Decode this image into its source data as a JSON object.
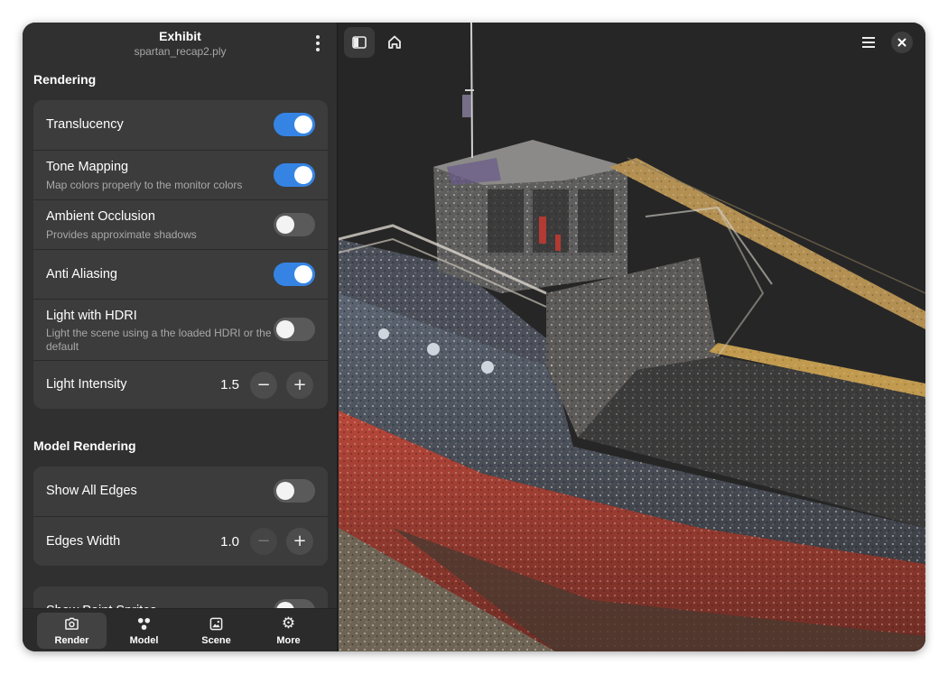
{
  "header": {
    "title": "Exhibit",
    "subtitle": "spartan_recap2.ply"
  },
  "rendering": {
    "section_title": "Rendering",
    "translucency": {
      "title": "Translucency",
      "enabled": true
    },
    "tone_mapping": {
      "title": "Tone Mapping",
      "subtitle": "Map colors properly to the monitor colors",
      "enabled": true
    },
    "ambient_occlusion": {
      "title": "Ambient Occlusion",
      "subtitle": "Provides approximate shadows",
      "enabled": false
    },
    "anti_aliasing": {
      "title": "Anti Aliasing",
      "enabled": true
    },
    "light_hdri": {
      "title": "Light with HDRI",
      "subtitle": "Light the scene using a the loaded HDRI or the default",
      "enabled": false
    },
    "light_intensity": {
      "title": "Light Intensity",
      "value": "1.5"
    }
  },
  "model_rendering": {
    "section_title": "Model Rendering",
    "show_all_edges": {
      "title": "Show All Edges",
      "enabled": false
    },
    "edges_width": {
      "title": "Edges Width",
      "value": "1.0"
    }
  },
  "point_sprites": {
    "title": "Show Point Sprites",
    "enabled": false
  },
  "tabs": [
    {
      "label": "Render",
      "icon": "camera-icon",
      "active": true
    },
    {
      "label": "Model",
      "icon": "model-icon",
      "active": false
    },
    {
      "label": "Scene",
      "icon": "image-icon",
      "active": false
    },
    {
      "label": "More",
      "icon": "gear-icon",
      "active": false
    }
  ],
  "viewport": {
    "buttons": [
      "sidebar-toggle-icon",
      "home-icon",
      "hamburger-menu-icon",
      "close-icon"
    ]
  },
  "colors": {
    "accent": "#3584e4",
    "sidebar_bg": "#303030",
    "card_bg": "#3c3c3c",
    "viewport_bg": "#262626"
  }
}
